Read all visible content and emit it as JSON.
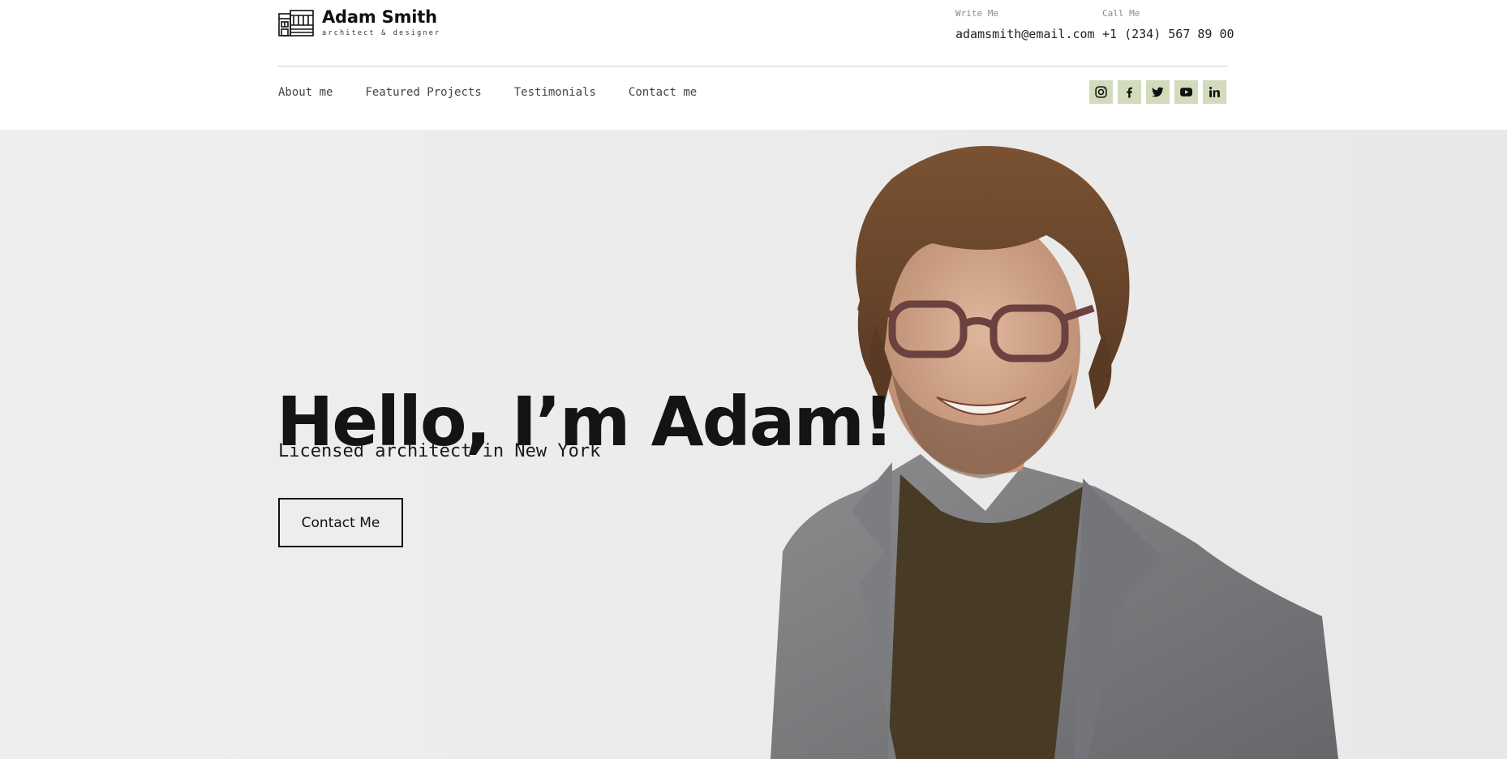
{
  "brand": {
    "name": "Adam Smith",
    "tagline": "architect & designer"
  },
  "contact": {
    "write_label": "Write Me",
    "email": "adamsmith@email.com",
    "call_label": "Call Me",
    "phone": "+1 (234) 567 89 00"
  },
  "nav": {
    "items": [
      "About me",
      "Featured Projects",
      "Testimonials",
      "Contact me"
    ]
  },
  "socials": [
    "instagram-icon",
    "facebook-icon",
    "twitter-icon",
    "youtube-icon",
    "linkedin-icon"
  ],
  "hero": {
    "title": "Hello, I’m Adam!",
    "subtitle": "Licensed architect in New York",
    "cta_label": "Contact Me"
  },
  "colors": {
    "social_bg": "#d3dbbd",
    "hero_bg": "#eeeeee",
    "text": "#111111"
  }
}
